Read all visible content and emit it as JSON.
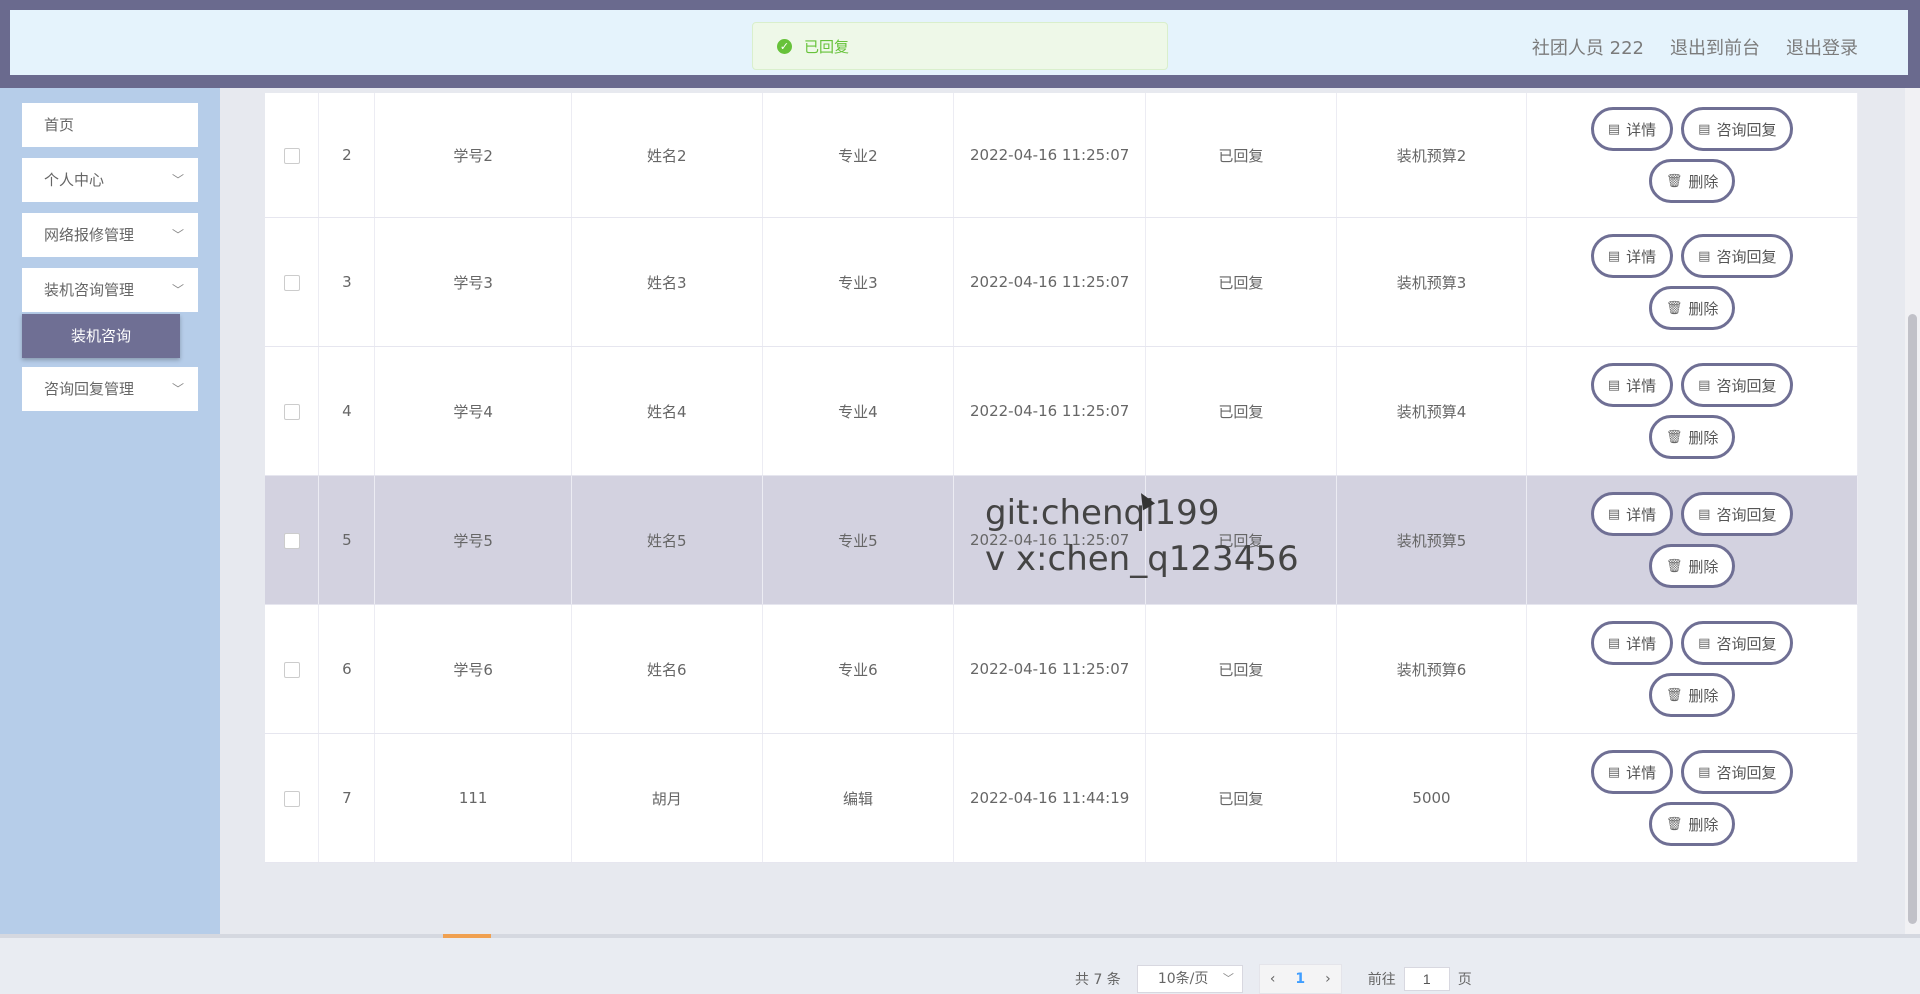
{
  "header": {
    "toast": "已回复",
    "user": "社团人员 222",
    "back_front": "退出到前台",
    "logout": "退出登录"
  },
  "sidebar": {
    "home": "首页",
    "personal": "个人中心",
    "repair": "网络报修管理",
    "consult": "装机咨询管理",
    "consult_sub": "装机咨询",
    "reply": "咨询回复管理"
  },
  "table": {
    "rows": [
      {
        "no": "2",
        "sid": "学号2",
        "name": "姓名2",
        "major": "专业2",
        "time": "2022-04-16 11:25:07",
        "status": "已回复",
        "budget": "装机预算2"
      },
      {
        "no": "3",
        "sid": "学号3",
        "name": "姓名3",
        "major": "专业3",
        "time": "2022-04-16 11:25:07",
        "status": "已回复",
        "budget": "装机预算3"
      },
      {
        "no": "4",
        "sid": "学号4",
        "name": "姓名4",
        "major": "专业4",
        "time": "2022-04-16 11:25:07",
        "status": "已回复",
        "budget": "装机预算4"
      },
      {
        "no": "5",
        "sid": "学号5",
        "name": "姓名5",
        "major": "专业5",
        "time": "2022-04-16 11:25:07",
        "status": "已回复",
        "budget": "装机预算5"
      },
      {
        "no": "6",
        "sid": "学号6",
        "name": "姓名6",
        "major": "专业6",
        "time": "2022-04-16 11:25:07",
        "status": "已回复",
        "budget": "装机预算6"
      },
      {
        "no": "7",
        "sid": "111",
        "name": "胡月",
        "major": "编辑",
        "time": "2022-04-16 11:44:19",
        "status": "已回复",
        "budget": "5000"
      }
    ],
    "btn_detail": "详情",
    "btn_reply": "咨询回复",
    "btn_delete": "删除"
  },
  "watermark": {
    "line1": "git:chenqi199",
    "line2": "v x:chen_q123456"
  },
  "pagination": {
    "total": "共 7 条",
    "page_size": "10条/页",
    "current": "1",
    "goto_label": "前往",
    "goto_value": "1",
    "page_unit": "页"
  }
}
